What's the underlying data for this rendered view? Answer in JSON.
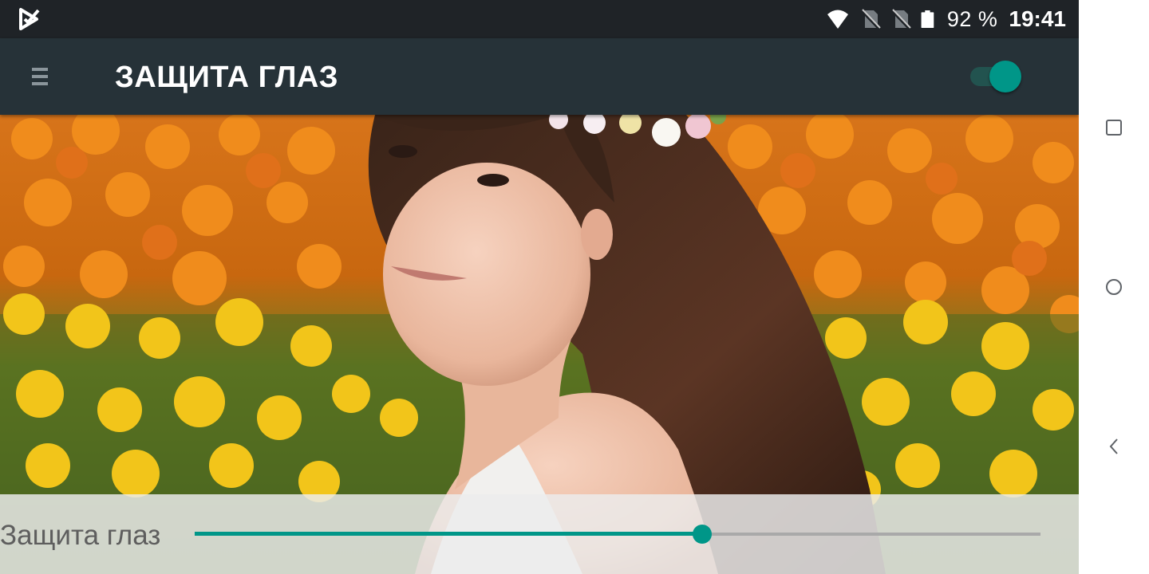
{
  "status_bar": {
    "battery_percent": "92 %",
    "time": "19:41",
    "icons": [
      "app-notification-icon",
      "wifi-icon",
      "no-sim-icon",
      "no-sim-icon",
      "battery-icon"
    ]
  },
  "toolbar": {
    "title": "ЗАЩИТА ГЛАЗ",
    "menu_icon": "hamburger-menu-icon",
    "switch_on": true
  },
  "preview": {
    "kind": "photo",
    "subject": "woman-in-flower-field"
  },
  "filter_panel": {
    "label": "Защита глаз",
    "slider_level": 0.6
  },
  "nav_bar": {
    "icons": [
      "recents-icon",
      "home-icon",
      "back-icon"
    ]
  },
  "colors": {
    "accent": "#009688",
    "toolbar": "#263238",
    "status_bar": "#1f2327"
  }
}
